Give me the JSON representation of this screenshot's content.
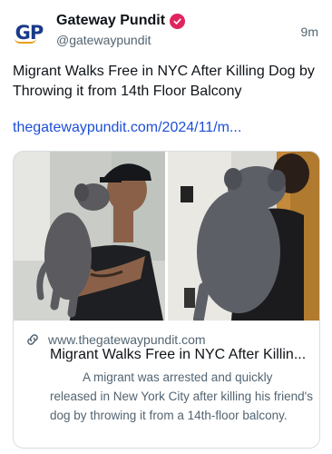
{
  "account": {
    "logo_text": "GP",
    "name": "Gateway Pundit",
    "handle": "@gatewaypundit",
    "time": "9m"
  },
  "post": {
    "text": "Migrant Walks Free in NYC After Killing Dog by Throwing it from 14th Floor Balcony",
    "link": "thegatewaypundit.com/2024/11/m..."
  },
  "card": {
    "domain": "www.thegatewaypundit.com",
    "title": "Migrant Walks Free in NYC After Killin...",
    "description": "A migrant was arrested and quickly released in New York City after killing his friend's dog by throwing it from a 14th-floor balcony."
  },
  "colors": {
    "brand_blue": "#1a3a8a",
    "brand_gold": "#e8a21b",
    "verified": "#e0245e",
    "link": "#1d4ed8"
  },
  "icons": {
    "verified": "verified-badge-icon",
    "link": "link-icon"
  }
}
